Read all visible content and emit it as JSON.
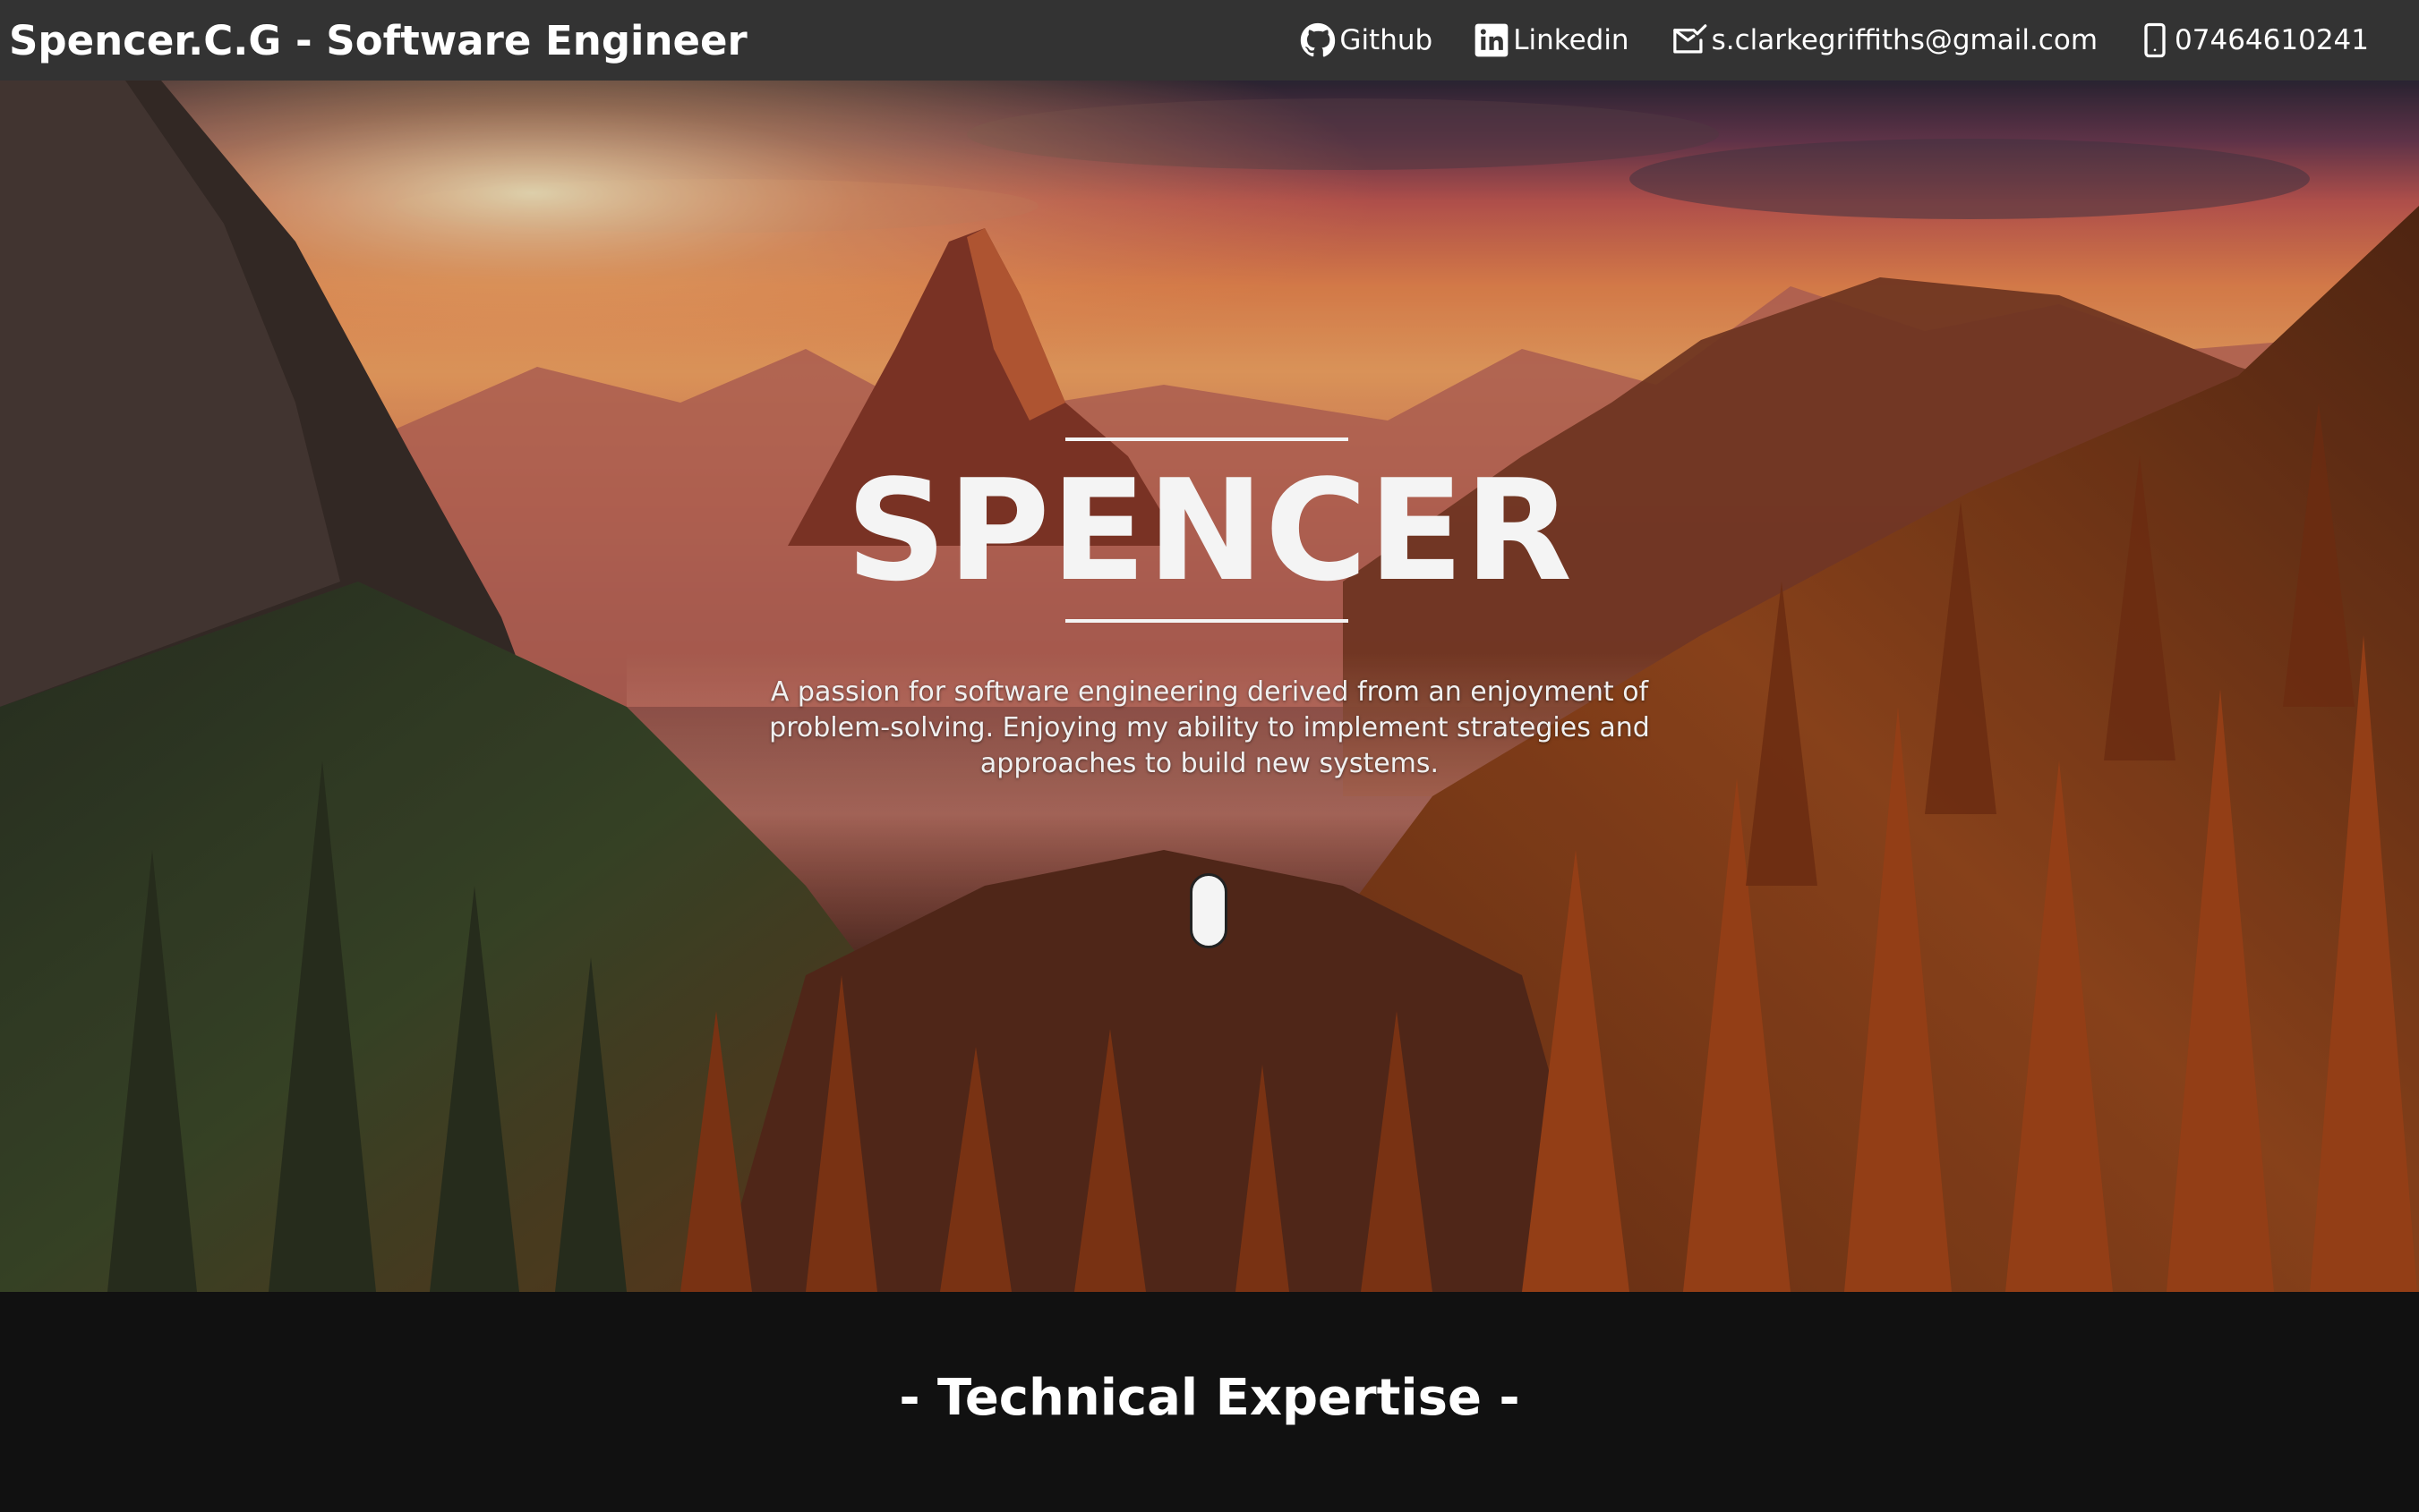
{
  "header": {
    "brand": "Spencer.C.G - Software Engineer",
    "links": [
      {
        "icon": "github-icon",
        "label": "Github"
      },
      {
        "icon": "linkedin-icon",
        "label": "Linkedin"
      },
      {
        "icon": "mail-icon",
        "label": "s.clarkegriffiths@gmail.com"
      },
      {
        "icon": "phone-icon",
        "label": "07464610241"
      }
    ]
  },
  "hero": {
    "title": "SPENCER",
    "tagline": "A passion for software engineering derived from an enjoyment of problem-solving. Enjoying my ability to implement strategies and approaches to build new systems.",
    "scroll_icon": "mouse-scroll-icon"
  },
  "section": {
    "heading": "- Technical Expertise -"
  },
  "colors": {
    "navbar": "#333333",
    "page_background": "#111111",
    "hero_text": "#f4f4f4"
  }
}
